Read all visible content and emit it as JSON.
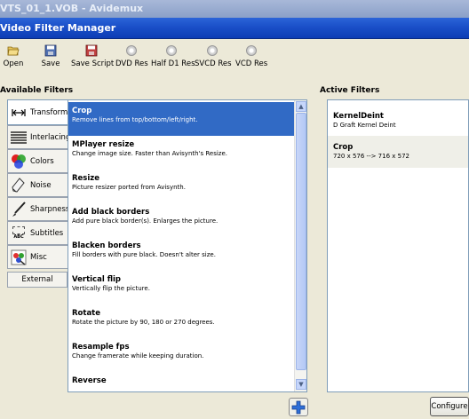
{
  "window": {
    "title": "VTS_01_1.VOB - Avidemux",
    "dialog_title": "Video Filter Manager"
  },
  "toolbar": {
    "buttons": [
      {
        "label": "Open",
        "icon": "folder-open-icon"
      },
      {
        "label": "Save",
        "icon": "floppy-disk-icon"
      },
      {
        "label": "Save Script",
        "icon": "script-disk-icon"
      },
      {
        "label": "DVD Res",
        "icon": "disc-icon"
      },
      {
        "label": "Half D1 Res",
        "icon": "disc-icon"
      },
      {
        "label": "SVCD Res",
        "icon": "disc-icon"
      },
      {
        "label": "VCD Res",
        "icon": "disc-icon"
      }
    ]
  },
  "available": {
    "heading": "Available Filters",
    "categories": [
      {
        "label": "Transform",
        "icon": "transform-icon"
      },
      {
        "label": "Interlacing",
        "icon": "interlacing-icon"
      },
      {
        "label": "Colors",
        "icon": "colors-icon"
      },
      {
        "label": "Noise",
        "icon": "noise-icon"
      },
      {
        "label": "Sharpness",
        "icon": "sharpness-icon"
      },
      {
        "label": "Subtitles",
        "icon": "subtitles-icon"
      },
      {
        "label": "Misc",
        "icon": "misc-icon"
      },
      {
        "label": "External",
        "icon": ""
      }
    ],
    "subtitles_icon_text": "ABC",
    "filters": [
      {
        "name": "Crop",
        "desc": "Remove lines from top/bottom/left/right."
      },
      {
        "name": "MPlayer resize",
        "desc": "Change image size. Faster than Avisynth's Resize."
      },
      {
        "name": "Resize",
        "desc": "Picture resizer ported from Avisynth."
      },
      {
        "name": "Add black borders",
        "desc": "Add pure black border(s). Enlarges the picture."
      },
      {
        "name": "Blacken borders",
        "desc": "Fill borders with pure black. Doesn't alter size."
      },
      {
        "name": "Vertical flip",
        "desc": "Vertically flip the picture."
      },
      {
        "name": "Rotate",
        "desc": "Rotate the picture by 90, 180 or 270 degrees."
      },
      {
        "name": "Resample fps",
        "desc": "Change framerate while keeping duration."
      },
      {
        "name": "Reverse",
        "desc": ""
      }
    ]
  },
  "active": {
    "heading": "Active Filters",
    "filters": [
      {
        "name": "KernelDeint",
        "desc": "D Graft Kernel Deint"
      },
      {
        "name": "Crop",
        "desc": "720 x 576 --> 716 x 572"
      }
    ]
  },
  "buttons": {
    "add": "+",
    "configure": "Configure"
  },
  "colors": {
    "selection": "#316ac5",
    "titlebar": "#1a4fc8",
    "dialog_bg": "#ece9d8"
  }
}
